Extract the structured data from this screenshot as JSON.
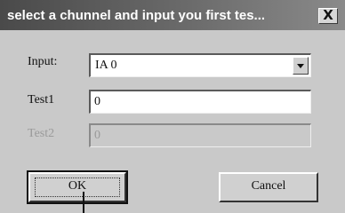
{
  "window": {
    "title": "select a chunnel and input you first tes...",
    "close_label": "X"
  },
  "form": {
    "input_label": "Input:",
    "input_value": "IA 0",
    "test1_label": "Test1",
    "test1_value": "0",
    "test2_label": "Test2",
    "test2_value": "0",
    "test2_enabled": false
  },
  "buttons": {
    "ok_label": "OK",
    "cancel_label": "Cancel"
  },
  "colors": {
    "title_bar": "#5a5a5a",
    "dialog_bg": "#c9c9c9",
    "disabled_text": "#9a9a9a"
  }
}
